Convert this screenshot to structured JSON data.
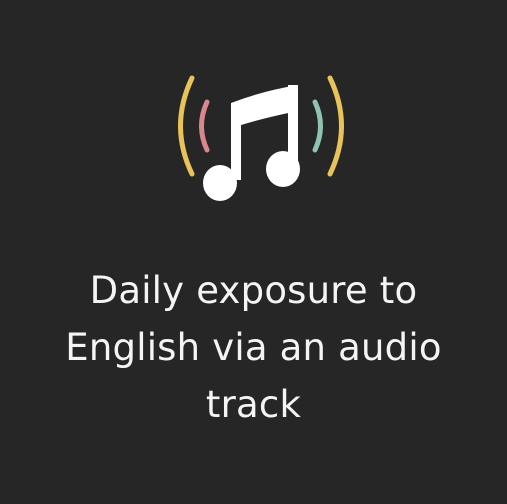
{
  "caption": {
    "line1": "Daily exposure to",
    "line2": "English via an audio",
    "line3": "track"
  },
  "icon": {
    "name": "music-note-with-sound-waves-icon",
    "colors": {
      "note": "#ffffff",
      "outer_wave": "#e8c35a",
      "left_inner_wave": "#d8878c",
      "right_inner_wave": "#8fc3b4"
    }
  },
  "background_color": "#262626"
}
